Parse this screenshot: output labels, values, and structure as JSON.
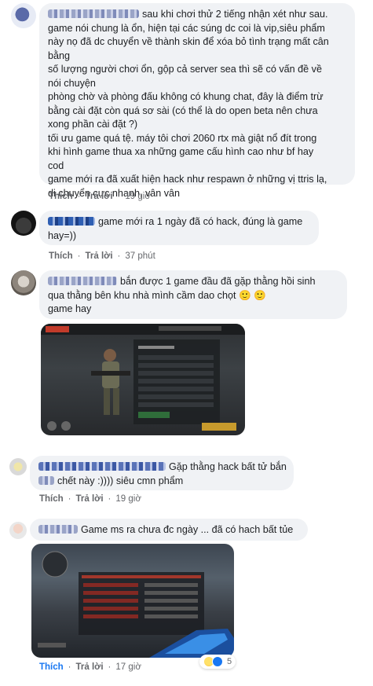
{
  "actions": {
    "like": "Thích",
    "reply": "Trả lời"
  },
  "comments": [
    {
      "lines": [
        "sau khi chơi thử 2 tiếng nhận xét như sau.",
        "game nói chung là ổn, hiện tại các súng dc coi là vip,siêu phẩm",
        "này nọ đã dc chuyển về thành skin để xóa bỏ tình trạng mất cân",
        "bằng",
        "số lượng người chơi ổn, gộp cả server sea thì sẽ có vấn đề về",
        "nói chuyện",
        "phòng chờ và phòng đấu không có khung chat, đây là điểm trừ",
        "bằng cài đặt còn quá sơ sài (có thể là do open beta nên chưa",
        "xong phần cài đặt ?)",
        "tối ưu game quá tệ. máy tôi chơi 2060 rtx mà giật nổ đít trong",
        "khi hình game thua xa những game cấu hình cao như bf hay",
        "cod",
        "game mới ra đã xuất hiện hack như respawn ở những vị ttris lạ,",
        "di chuyển cực nhanh, vân vân"
      ],
      "time": "19 giờ"
    },
    {
      "lines": [
        "game mới ra 1 ngày đã có hack, đúng là game",
        "hay=))"
      ],
      "time": "37 phút"
    },
    {
      "lines": [
        "bắn được 1 game đầu đã gặp thằng hồi sinh",
        "qua thằng bên khu nhà mình cầm dao chọt 🙂 🙂",
        "game hay"
      ],
      "time": ""
    },
    {
      "lines": [
        "Gặp thằng hack bất tử bắn",
        "chết này :)))) siêu cmn phẩm"
      ],
      "time": "19 giờ"
    },
    {
      "lines": [
        "Game ms ra chưa đc ngày ... đã có hach bất tủe"
      ],
      "time": "17 giờ",
      "reaction_count": "5"
    }
  ]
}
